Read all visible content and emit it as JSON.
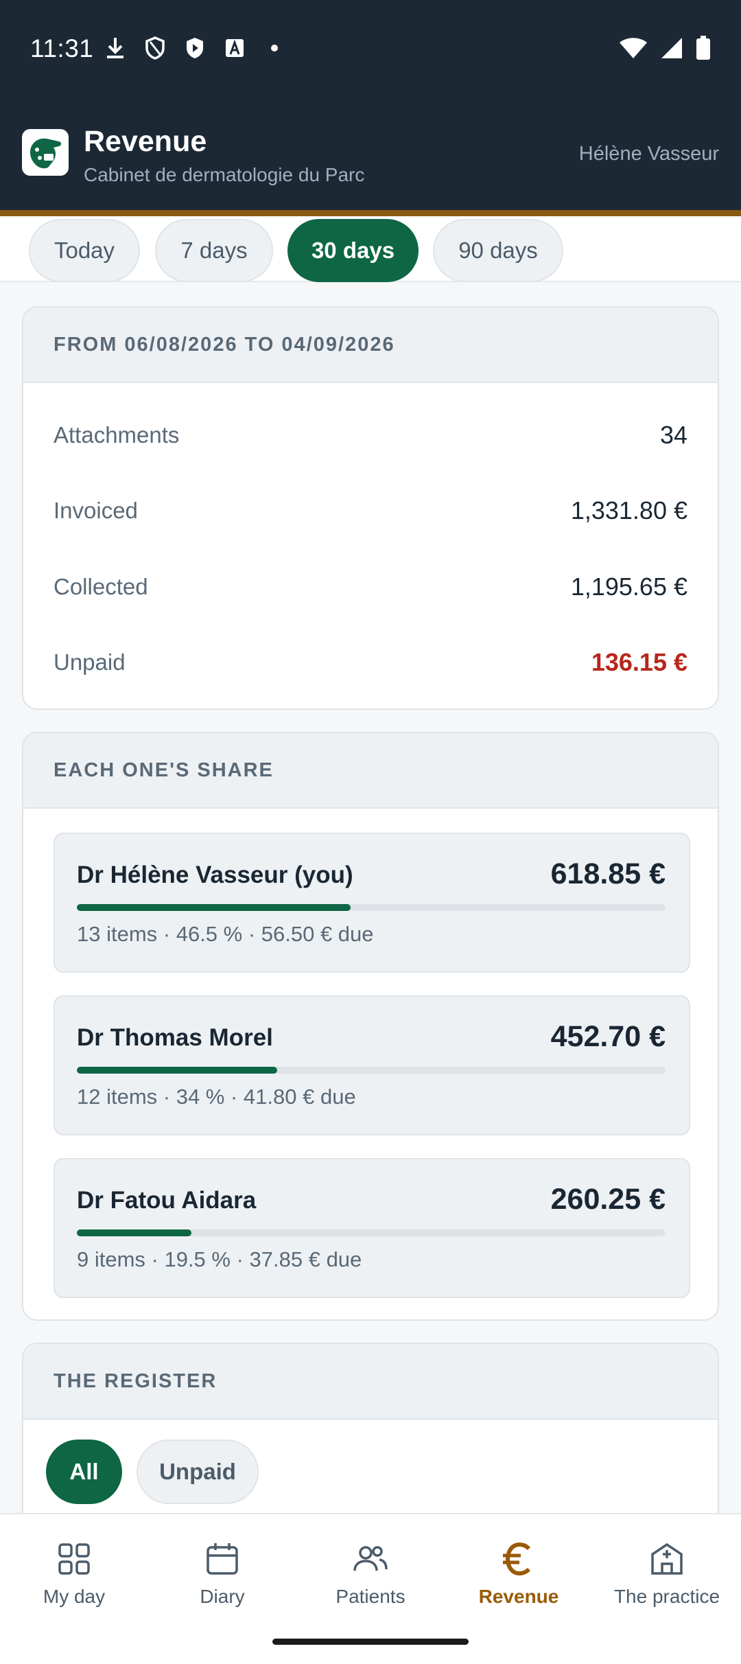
{
  "status_bar": {
    "time": "11:31",
    "icons": [
      "download-icon",
      "shield-outline-icon",
      "shield-play-icon",
      "font-a-icon",
      "dot-icon"
    ],
    "right_icons": [
      "wifi-icon",
      "signal-icon",
      "battery-icon"
    ]
  },
  "header": {
    "title": "Revenue",
    "subtitle": "Cabinet de dermatologie du Parc",
    "user": "Hélène Vasseur"
  },
  "periods": [
    {
      "label": "Today",
      "active": false
    },
    {
      "label": "7 days",
      "active": false
    },
    {
      "label": "30 days",
      "active": true
    },
    {
      "label": "90 days",
      "active": false
    }
  ],
  "summary": {
    "range": "FROM 06/08/2026 TO 04/09/2026",
    "rows": [
      {
        "label": "Attachments",
        "value": "34"
      },
      {
        "label": "Invoiced",
        "value": "1,331.80 €"
      },
      {
        "label": "Collected",
        "value": "1,195.65 €"
      },
      {
        "label": "Unpaid",
        "value": "136.15 €"
      }
    ]
  },
  "shares": {
    "title": "EACH ONE'S SHARE",
    "items": [
      {
        "name": "Dr Hélène Vasseur (you)",
        "amount": "618.85 €",
        "meta": "13 items · 46.5 % · 56.50 € due",
        "fraction": 0.465
      },
      {
        "name": "Dr Thomas Morel",
        "amount": "452.70 €",
        "meta": "12 items · 34 % · 41.80 € due",
        "fraction": 0.34
      },
      {
        "name": "Dr Fatou Aidara",
        "amount": "260.25 €",
        "meta": "9 items · 19.5 % · 37.85 € due",
        "fraction": 0.195
      }
    ]
  },
  "register": {
    "title": "THE REGISTER",
    "filters": [
      {
        "label": "All",
        "active": true
      },
      {
        "label": "Unpaid",
        "active": false
      }
    ]
  },
  "nav": [
    {
      "label": "My day",
      "icon": "grid-icon",
      "active": false
    },
    {
      "label": "Diary",
      "icon": "calendar-icon",
      "active": false
    },
    {
      "label": "Patients",
      "icon": "people-icon",
      "active": false
    },
    {
      "label": "Revenue",
      "icon": "euro-icon",
      "active": true
    },
    {
      "label": "The practice",
      "icon": "building-icon",
      "active": false
    }
  ],
  "colors": {
    "header_bg": "#1c2935",
    "accent_green": "#0e6645",
    "accent_brown": "#8a5a12",
    "unpaid_red": "#b8261c"
  }
}
